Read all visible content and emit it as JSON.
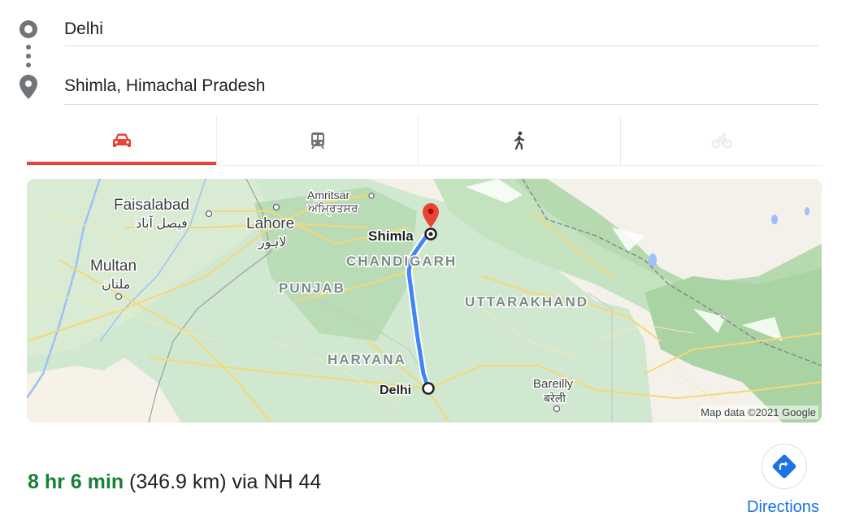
{
  "route": {
    "from": "Delhi",
    "to": "Shimla, Himachal Pradesh"
  },
  "modes": [
    {
      "name": "car-icon",
      "active": true,
      "color": "#ea4335"
    },
    {
      "name": "train-icon",
      "active": false,
      "color": "#70757a"
    },
    {
      "name": "walk-icon",
      "active": false,
      "color": "#3c4043"
    },
    {
      "name": "bicycle-icon",
      "active": false,
      "color": "#e8eaed"
    }
  ],
  "map": {
    "labels": {
      "faisalabad": "Faisalabad",
      "faisalabad_ur": "فیصل آباد",
      "amritsar": "Amritsar",
      "amritsar_pa": "ਅੰਮ੍ਰਿਤਸਰ",
      "lahore": "Lahore",
      "lahore_ur": "لاہور",
      "multan": "Multan",
      "multan_ur": "ملتان",
      "shimla": "Shimla",
      "chandigarh": "CHANDIGARH",
      "punjab": "PUNJAB",
      "uttarakhand": "UTTARAKHAND",
      "haryana": "HARYANA",
      "delhi": "Delhi",
      "bareilly": "Bareilly",
      "bareilly_hi": "बरेली"
    },
    "attribution": "Map data ©2021 Google",
    "route_color": "#4285f4",
    "destination_pin_color": "#ea4335"
  },
  "summary": {
    "duration": "8 hr 6 min",
    "distance": "(346.9 km)",
    "via": "via NH 44"
  },
  "directions": {
    "label": "Directions",
    "icon": "directions-icon"
  }
}
